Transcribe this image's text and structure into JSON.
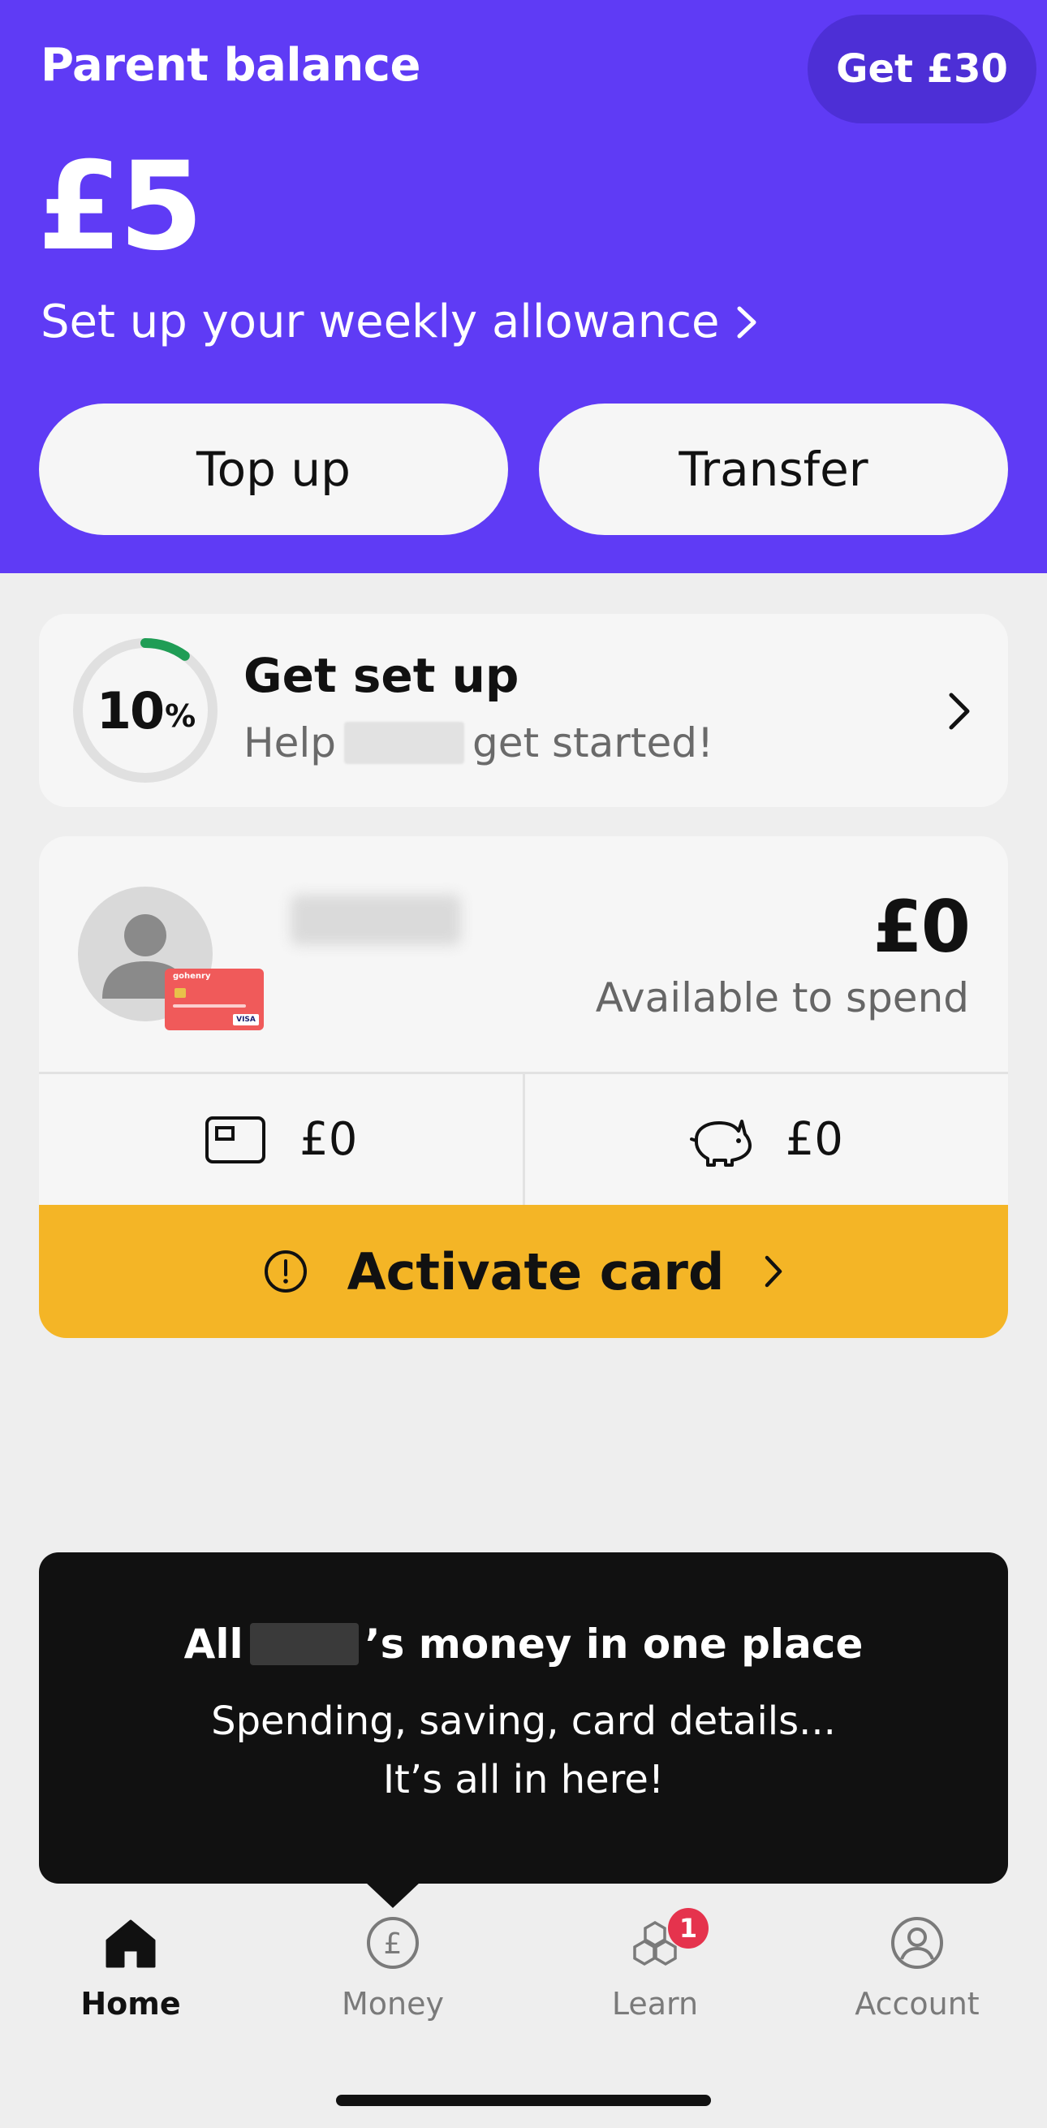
{
  "header": {
    "title": "Parent balance",
    "promo_label": "Get £30",
    "balance": "£5",
    "allowance_link": "Set up your weekly allowance",
    "topup_label": "Top up",
    "transfer_label": "Transfer",
    "bg_color": "#5f3bf5"
  },
  "setup": {
    "progress_value": "10",
    "progress_unit": "%",
    "progress_fraction": 0.1,
    "title": "Get set up",
    "subtitle_before": "Help",
    "subtitle_after": "get started!"
  },
  "child": {
    "balance": "£0",
    "balance_caption": "Available to spend",
    "card_brand": "gohenry",
    "card_network": "VISA",
    "card_amount": "£0",
    "savings_amount": "£0",
    "activate_label": "Activate card",
    "activate_color": "#f4b526"
  },
  "tooltip": {
    "title_before": "All",
    "title_after": "’s money in one place",
    "line1": "Spending, saving, card details...",
    "line2": "It’s all in here!"
  },
  "nav": {
    "home": "Home",
    "money": "Money",
    "learn": "Learn",
    "learn_badge": "1",
    "account": "Account"
  }
}
